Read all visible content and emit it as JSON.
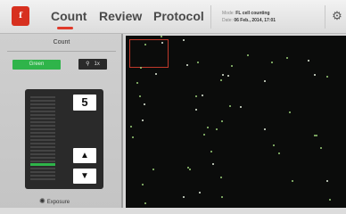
{
  "app": {
    "logo_text": "f"
  },
  "tabs": [
    {
      "label": "Count",
      "active": true
    },
    {
      "label": "Review",
      "active": false
    },
    {
      "label": "Protocol",
      "active": false
    }
  ],
  "info": {
    "mode_key": "Mode:",
    "mode_value": "FL cell counting",
    "date_key": "Date:",
    "date_value": "06 Feb., 2014, 17:01"
  },
  "left_panel": {
    "title": "Count",
    "channel_button": "Green",
    "zoom_button": "1x",
    "exposure_value": "5",
    "exposure_level_fraction": 0.2,
    "up_label": "▲",
    "down_label": "▼",
    "exposure_label": "Exposure"
  },
  "colors": {
    "accent": "#e03a2b",
    "channel": "#2fb44a",
    "image_bg": "#0b0c0b"
  },
  "icons": {
    "settings": "gear-icon",
    "zoom": "magnifier-icon",
    "exposure": "bulb-icon"
  }
}
